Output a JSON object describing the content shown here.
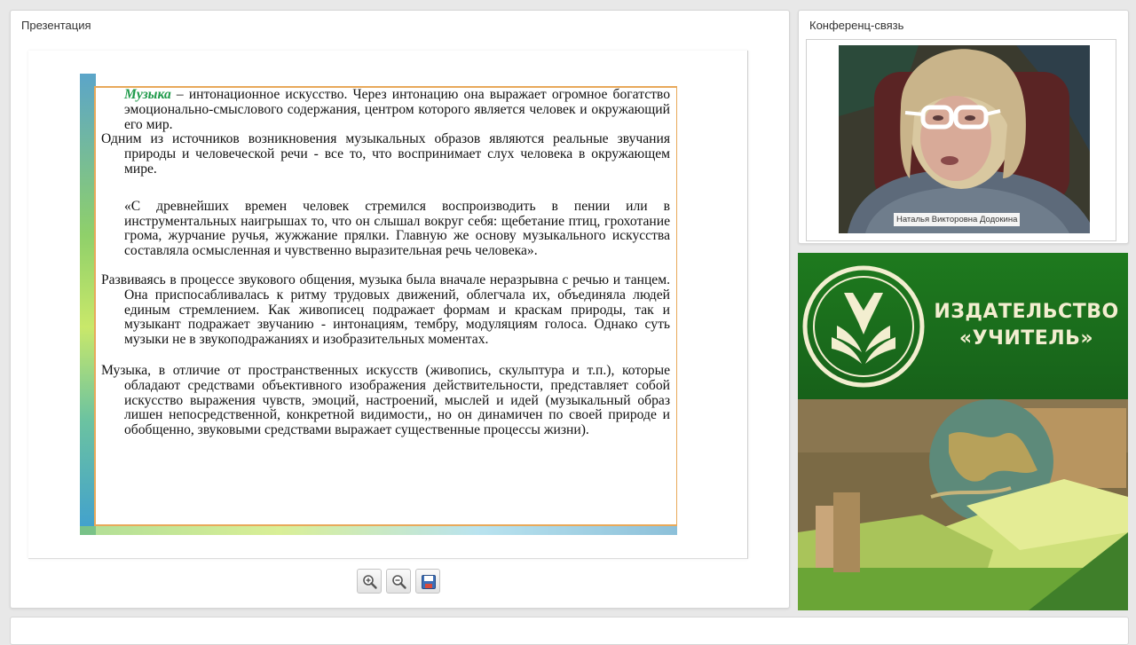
{
  "presentation": {
    "title": "Презентация",
    "slide": {
      "p1_term": "Музыка",
      "p1_rest": " – интонационное искусство. Через интонацию она выражает огромное богатство эмоционально-смыслового содержания, центром которого является человек и окружающий его мир.",
      "p2": "Одним из источников возникновения музыкальных образов являются реальные звучания природы и человеческой речи - все то, что воспринимает слух человека в окружающем мире.",
      "p3": "«С древнейших времен человек стремился воспроизводить в пении или в инструментальных наигрышах то, что он слышал вокруг себя: щебетание птиц, грохотание грома, журчание ручья, жужжание прялки. Главную же основу музыкального искусства составляла осмысленная и чувственно выразительная речь человека».",
      "p4": "Развиваясь в процессе звукового общения, музыка была вначале неразрывна с речью и танцем. Она приспосабливалась к ритму трудовых движений, облегчала их, объединяла людей единым стремлением. Как живописец подражает формам и краскам природы, так и музыкант подражает звучанию - интонациям, тембру, модуляциям голоса. Однако суть музыки не в звукоподражаниях и изобразительных моментах.",
      "p5": "Музыка, в отличие от пространственных искусств (живопись, скульптура и т.п.), которые обладают средствами объективного изображения действительности, представляет собой искусство выражения чувств, эмоций, настроений, мыслей и идей (музыкальный образ лишен непосредственной, конкретной видимости,, но он динамичен по своей природе и обобщенно, звуковыми средствами выражает существенные процессы жизни)."
    },
    "toolbar": {
      "zoom_in_icon": "zoom-in-icon",
      "zoom_out_icon": "zoom-out-icon",
      "save_icon": "floppy-disk-icon"
    }
  },
  "conference": {
    "title": "Конференц-связь",
    "participant_name": "Наталья Викторовна Додокина"
  },
  "publisher": {
    "line1": "ИЗДАТЕЛЬСТВО",
    "line2": "«УЧИТЕЛЬ»"
  },
  "colors": {
    "accent_green": "#1f9a4a",
    "frame_orange": "#e8a95a",
    "banner_green": "#1d6b1d"
  }
}
